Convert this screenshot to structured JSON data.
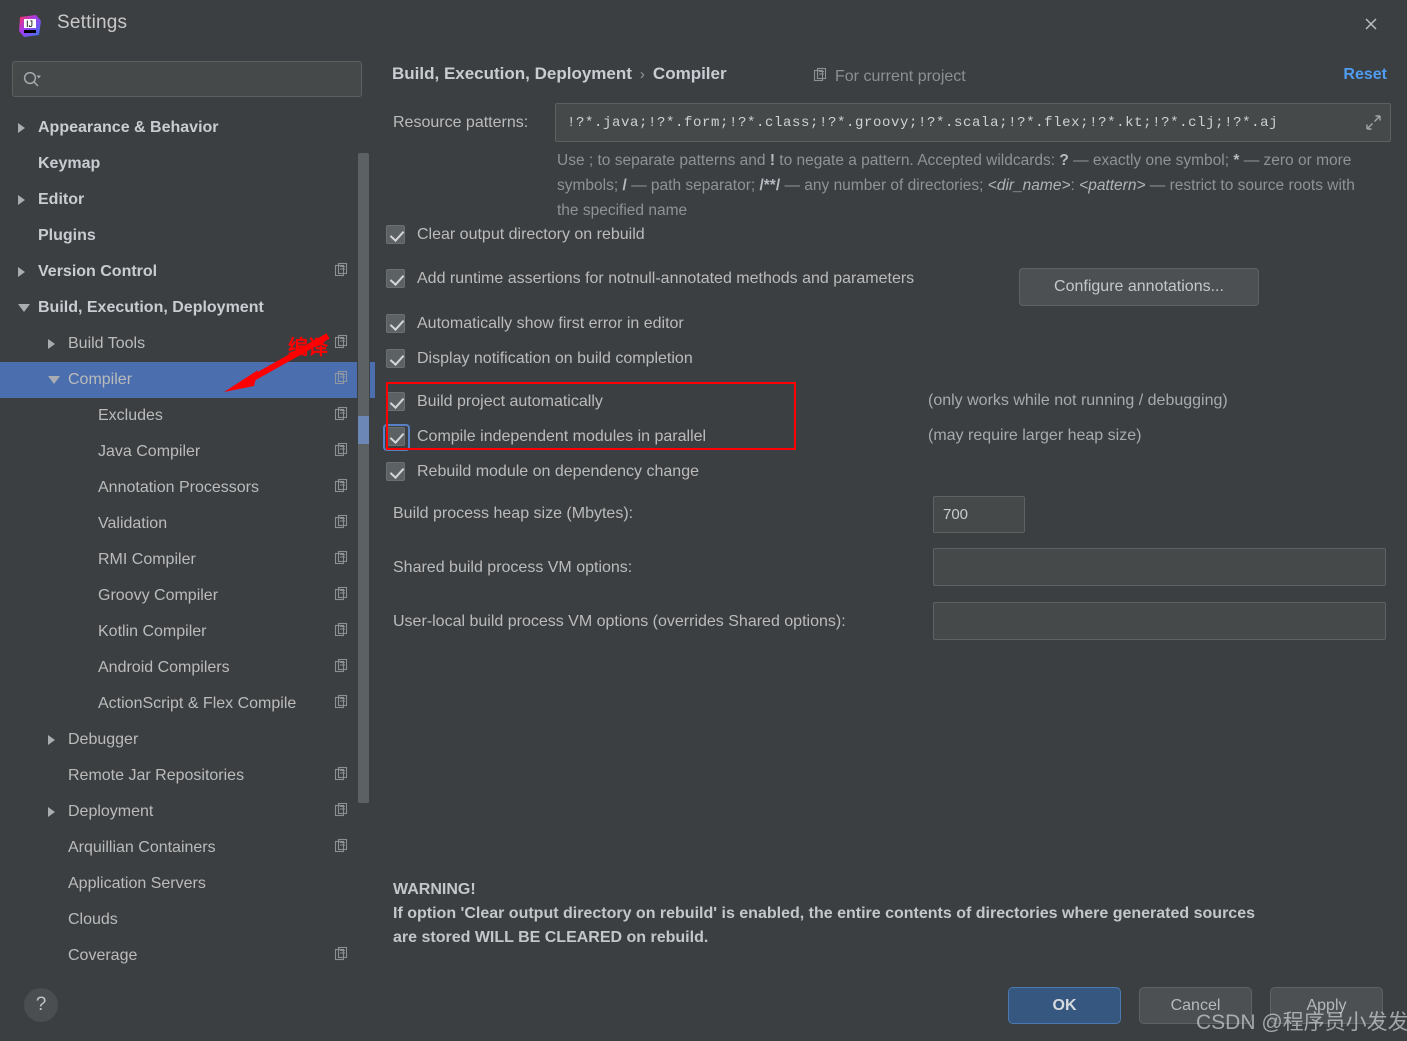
{
  "window": {
    "title": "Settings",
    "app_icon": "intellij-idea-icon",
    "close_icon": "close-icon"
  },
  "sidebar": {
    "search": {
      "placeholder": "",
      "value": "",
      "icon": "search-icon"
    },
    "items": [
      {
        "label": "Appearance & Behavior",
        "indent": 0,
        "arrow": "right",
        "bold": true,
        "badge": false
      },
      {
        "label": "Keymap",
        "indent": 0,
        "arrow": "none",
        "bold": true,
        "badge": false
      },
      {
        "label": "Editor",
        "indent": 0,
        "arrow": "right",
        "bold": true,
        "badge": false
      },
      {
        "label": "Plugins",
        "indent": 0,
        "arrow": "none",
        "bold": true,
        "badge": false
      },
      {
        "label": "Version Control",
        "indent": 0,
        "arrow": "right",
        "bold": true,
        "badge": true
      },
      {
        "label": "Build, Execution, Deployment",
        "indent": 0,
        "arrow": "down",
        "bold": true,
        "badge": false
      },
      {
        "label": "Build Tools",
        "indent": 1,
        "arrow": "right",
        "bold": false,
        "badge": true
      },
      {
        "label": "Compiler",
        "indent": 1,
        "arrow": "down",
        "bold": false,
        "badge": true,
        "selected": true
      },
      {
        "label": "Excludes",
        "indent": 2,
        "arrow": "none",
        "bold": false,
        "badge": true
      },
      {
        "label": "Java Compiler",
        "indent": 2,
        "arrow": "none",
        "bold": false,
        "badge": true
      },
      {
        "label": "Annotation Processors",
        "indent": 2,
        "arrow": "none",
        "bold": false,
        "badge": true
      },
      {
        "label": "Validation",
        "indent": 2,
        "arrow": "none",
        "bold": false,
        "badge": true
      },
      {
        "label": "RMI Compiler",
        "indent": 2,
        "arrow": "none",
        "bold": false,
        "badge": true
      },
      {
        "label": "Groovy Compiler",
        "indent": 2,
        "arrow": "none",
        "bold": false,
        "badge": true
      },
      {
        "label": "Kotlin Compiler",
        "indent": 2,
        "arrow": "none",
        "bold": false,
        "badge": true
      },
      {
        "label": "Android Compilers",
        "indent": 2,
        "arrow": "none",
        "bold": false,
        "badge": true
      },
      {
        "label": "ActionScript & Flex Compile",
        "indent": 2,
        "arrow": "none",
        "bold": false,
        "badge": true
      },
      {
        "label": "Debugger",
        "indent": 1,
        "arrow": "right",
        "bold": false,
        "badge": false
      },
      {
        "label": "Remote Jar Repositories",
        "indent": 1,
        "arrow": "none",
        "bold": false,
        "badge": true
      },
      {
        "label": "Deployment",
        "indent": 1,
        "arrow": "right",
        "bold": false,
        "badge": true
      },
      {
        "label": "Arquillian Containers",
        "indent": 1,
        "arrow": "none",
        "bold": false,
        "badge": true
      },
      {
        "label": "Application Servers",
        "indent": 1,
        "arrow": "none",
        "bold": false,
        "badge": false
      },
      {
        "label": "Clouds",
        "indent": 1,
        "arrow": "none",
        "bold": false,
        "badge": false
      },
      {
        "label": "Coverage",
        "indent": 1,
        "arrow": "none",
        "bold": false,
        "badge": true
      }
    ]
  },
  "panel": {
    "breadcrumb_root": "Build, Execution, Deployment",
    "breadcrumb_sep": "›",
    "breadcrumb_leaf": "Compiler",
    "for_project": "For current project",
    "for_project_icon": "project-scope-icon",
    "reset": "Reset",
    "resource_patterns": {
      "label": "Resource patterns:",
      "value": "!?*.java;!?*.form;!?*.class;!?*.groovy;!?*.scala;!?*.flex;!?*.kt;!?*.clj;!?*.aj",
      "expand_icon": "expand-icon",
      "hint_line1_a": "Use ; to separate patterns and ",
      "hint_line1_b": "!",
      "hint_line1_c": " to negate a pattern. Accepted wildcards: ",
      "hint_line1_d": "?",
      "hint_line1_e": " — exactly one symbol; ",
      "hint_line1_f": "*",
      "hint_line2_a": " — zero or more symbols; ",
      "hint_line2_b": "/",
      "hint_line2_c": " — path separator; ",
      "hint_line2_d": "/**/",
      "hint_line2_e": " — any number of directories; ",
      "hint_line2_f": "<dir_name>",
      "hint_line2_g": ":",
      "hint_line3_a": "<pattern>",
      "hint_line3_b": " — restrict to source roots with the specified name"
    },
    "checkboxes": [
      {
        "label": "Clear output directory on rebuild",
        "checked": true,
        "focused": false
      },
      {
        "label": "Add runtime assertions for notnull-annotated methods and parameters",
        "checked": true,
        "focused": false
      },
      {
        "label": "Automatically show first error in editor",
        "checked": true,
        "focused": false
      },
      {
        "label": "Display notification on build completion",
        "checked": true,
        "focused": false
      },
      {
        "label": "Build project automatically",
        "checked": true,
        "focused": false
      },
      {
        "label": "Compile independent modules in parallel",
        "checked": true,
        "focused": true
      },
      {
        "label": "Rebuild module on dependency change",
        "checked": true,
        "focused": false
      }
    ],
    "configure_annotations_button": "Configure annotations...",
    "note_build_auto": "(only works while not running / debugging)",
    "note_parallel": "(may require larger heap size)",
    "heap": {
      "label": "Build process heap size (Mbytes):",
      "value": "700"
    },
    "shared_vm": {
      "label": "Shared build process VM options:",
      "value": ""
    },
    "user_vm": {
      "label": "User-local build process VM options (overrides Shared options):",
      "value": ""
    },
    "warning_title": "WARNING!",
    "warning_line1": "If option 'Clear output directory on rebuild' is enabled, the entire contents of directories where generated sources",
    "warning_line2": "are stored WILL BE CLEARED on rebuild."
  },
  "footer": {
    "help": "?",
    "ok": "OK",
    "cancel": "Cancel",
    "apply": "Apply"
  },
  "annotation": {
    "text": "编译",
    "color": "#ff0000"
  },
  "watermark": "CSDN @程序员小发发",
  "colors": {
    "background": "#3c3f41",
    "selection": "#4b6eaf",
    "accent_link": "#4f9cf0",
    "ok_button": "#365880",
    "annotation_red": "#ff0000"
  }
}
